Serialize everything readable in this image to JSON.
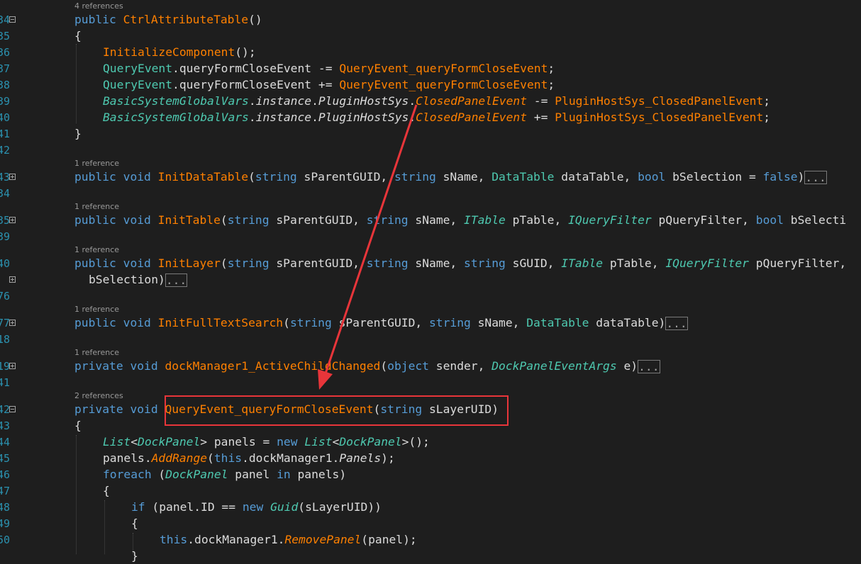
{
  "line_numbers": [
    "34",
    "35",
    "36",
    "37",
    "38",
    "39",
    "40",
    "41",
    "42",
    "43",
    "34",
    "35",
    "39",
    "40",
    "76",
    "77",
    "18",
    "19",
    "41",
    "42",
    "43",
    "44",
    "45",
    "46",
    "47",
    "48",
    "49",
    "50"
  ],
  "code_lens": {
    "ctor": "4 references",
    "init_data_table": "1 reference",
    "init_table": "1 reference",
    "init_layer": "1 reference",
    "init_full_text": "1 reference",
    "dock_changed": "1 reference",
    "close_event": "2 references"
  },
  "code": {
    "l1_kw": "public",
    "l1_name": "CtrlAttributeTable",
    "l1_rest": "()",
    "l2": "{",
    "l3_name": "InitializeComponent",
    "l3_rest": "();",
    "l4_a": "QueryEvent",
    "l4_b": ".",
    "l4_c": "queryFormCloseEvent",
    "l4_op": " -= ",
    "l4_d": "QueryEvent_queryFormCloseEvent",
    "l4_e": ";",
    "l5_a": "QueryEvent",
    "l5_b": ".",
    "l5_c": "queryFormCloseEvent",
    "l5_op": " += ",
    "l5_d": "QueryEvent_queryFormCloseEvent",
    "l5_e": ";",
    "l6_a": "BasicSystemGlobalVars",
    "l6_b": ".",
    "l6_c": "instance",
    "l6_d": ".",
    "l6_e": "PluginHostSys",
    "l6_f": ".",
    "l6_g": "ClosedPanelEvent",
    "l6_op": " -= ",
    "l6_h": "PluginHostSys_ClosedPanelEvent",
    "l6_i": ";",
    "l7_a": "BasicSystemGlobalVars",
    "l7_b": ".",
    "l7_c": "instance",
    "l7_d": ".",
    "l7_e": "PluginHostSys",
    "l7_f": ".",
    "l7_g": "ClosedPanelEvent",
    "l7_op": " += ",
    "l7_h": "PluginHostSys_ClosedPanelEvent",
    "l7_i": ";",
    "l8": "}",
    "m1_kw1": "public",
    "m1_kw2": "void",
    "m1_name": "InitDataTable",
    "m1_p0": "(",
    "m1_kw3": "string",
    "m1_p1": " sParentGUID, ",
    "m1_kw4": "string",
    "m1_p2": " sName, ",
    "m1_t1": "DataTable",
    "m1_p3": " dataTable, ",
    "m1_kw5": "bool",
    "m1_p4": " bSelection = ",
    "m1_kw6": "false",
    "m1_p5": ")",
    "m2_kw1": "public",
    "m2_kw2": "void",
    "m2_name": "InitTable",
    "m2_p0": "(",
    "m2_kw3": "string",
    "m2_p1": " sParentGUID, ",
    "m2_kw4": "string",
    "m2_p2": " sName, ",
    "m2_t1": "ITable",
    "m2_p3": " pTable, ",
    "m2_t2": "IQueryFilter",
    "m2_p4": " pQueryFilter, ",
    "m2_kw5": "bool",
    "m2_p5": " bSelecti",
    "m3_kw1": "public",
    "m3_kw2": "void",
    "m3_name": "InitLayer",
    "m3_p0": "(",
    "m3_kw3": "string",
    "m3_p1": " sParentGUID, ",
    "m3_kw4": "string",
    "m3_p2": " sName, ",
    "m3_kw5": "string",
    "m3_p3": " sGUID, ",
    "m3_t1": "ITable",
    "m3_p4": " pTable, ",
    "m3_t2": "IQueryFilter",
    "m3_p5": " pQueryFilter,",
    "m3b_text": "bSelection)",
    "m4_kw1": "public",
    "m4_kw2": "void",
    "m4_name": "InitFullTextSearch",
    "m4_p0": "(",
    "m4_kw3": "string",
    "m4_p1": " sParentGUID, ",
    "m4_kw4": "string",
    "m4_p2": " sName, ",
    "m4_t1": "DataTable",
    "m4_p3": " dataTable)",
    "m5_kw1": "private",
    "m5_kw2": "void",
    "m5_name": "dockManager1_ActiveChildChanged",
    "m5_p0": "(",
    "m5_kw3": "object",
    "m5_p1": " sender, ",
    "m5_t1": "DockPanelEventArgs",
    "m5_p2": " e)",
    "m6_kw1": "private",
    "m6_kw2": "void",
    "m6_name": "QueryEvent_queryFormCloseEvent",
    "m6_p0": "(",
    "m6_kw3": "string",
    "m6_p1": " sLayerUID)",
    "b1": "{",
    "b2_t1": "List",
    "b2_lt": "<",
    "b2_t2": "DockPanel",
    "b2_gt": ">",
    "b2_p1": " panels = ",
    "b2_kw": "new",
    "b2_sp": " ",
    "b2_t3": "List",
    "b2_lt2": "<",
    "b2_t4": "DockPanel",
    "b2_gt2": ">",
    "b2_end": "();",
    "b3_a": "panels.",
    "b3_m": "AddRange",
    "b3_p": "(",
    "b3_kw": "this",
    "b3_b": ".dockManager1.",
    "b3_c": "Panels",
    "b3_e": ");",
    "b4_kw": "foreach",
    "b4_a": " (",
    "b4_t": "DockPanel",
    "b4_b": " panel ",
    "b4_kw2": "in",
    "b4_c": " panels)",
    "b5": "{",
    "b6_kw": "if",
    "b6_a": " (panel.ID == ",
    "b6_kw2": "new",
    "b6_sp": " ",
    "b6_t": "Guid",
    "b6_b": "(sLayerUID))",
    "b7": "{",
    "b8_kw": "this",
    "b8_a": ".dockManager1.",
    "b8_m": "RemovePanel",
    "b8_b": "(panel);",
    "b9": "}",
    "collapsed": "..."
  },
  "colors": {
    "background": "#1e1e1e",
    "keyword": "#569cd6",
    "method": "#ff8000",
    "type": "#4ec9b0",
    "annotation": "#e8353a"
  }
}
